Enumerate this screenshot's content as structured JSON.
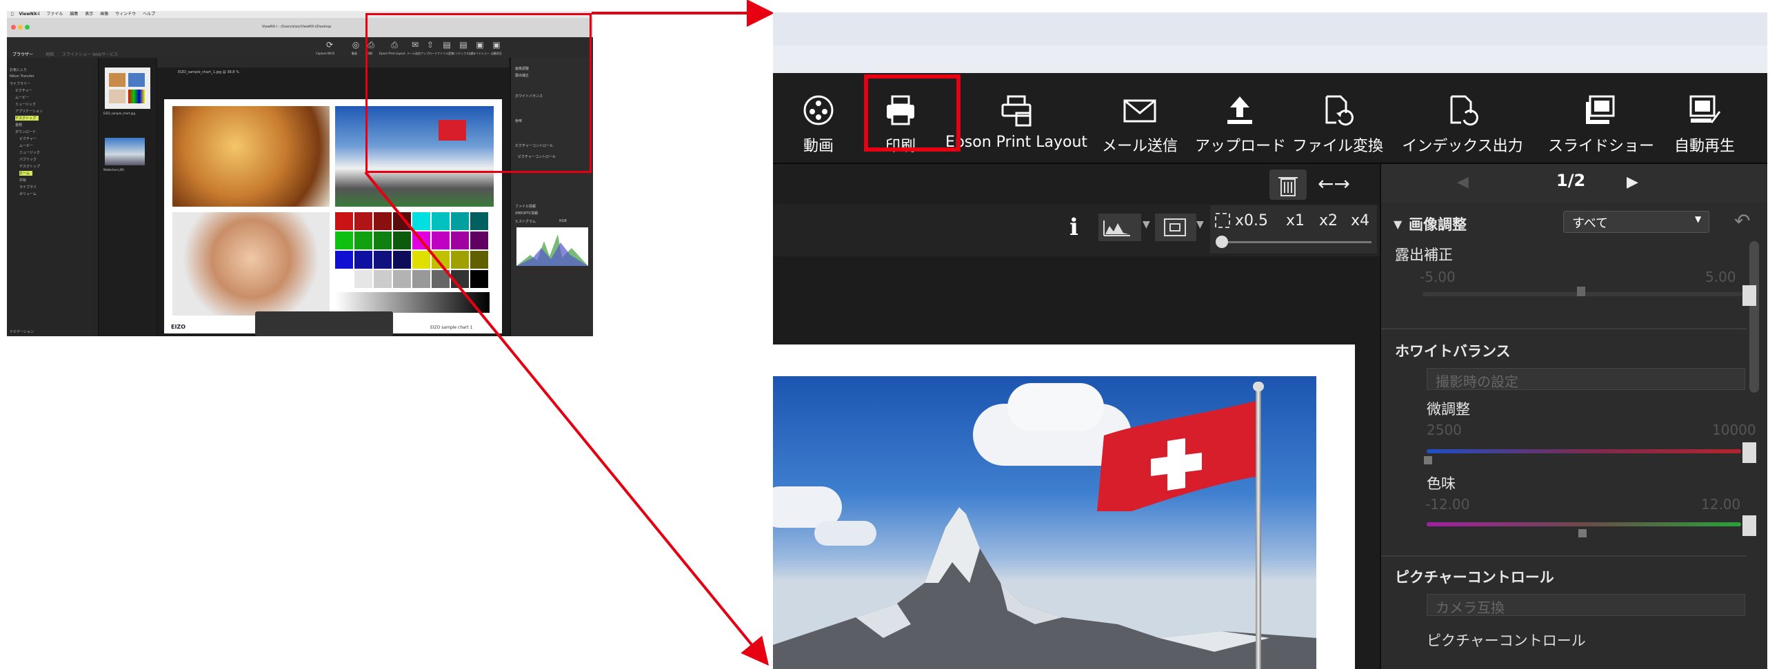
{
  "mini": {
    "menu": [
      "ViewNX-i",
      "ファイル",
      "編集",
      "表示",
      "画像",
      "ウィンドウ",
      "ヘルプ"
    ],
    "window_title": "ViewNX-i - /Users/eizo/ViewNX-i/Desktop",
    "tabs": [
      "ブラウザー",
      "地図",
      "スライドショー",
      "Webサービス"
    ],
    "toolbar_buttons": [
      "Capture NX-D",
      "動画",
      "印刷",
      "Epson Print Layout",
      "メール送信",
      "アップロード",
      "ファイル変換",
      "インデックス出力",
      "スライドショー",
      "自動再生"
    ],
    "tree": [
      "お気に入り",
      "Nikon Transfer",
      "ライブラリー",
      "ピクチャー",
      "ムービー",
      "ミュージック",
      "アプリケーション",
      "デスクトップ",
      "書類",
      "ダウンロード",
      "ピクチャー",
      "ムービー",
      "ミュージック",
      "パブリック",
      "デスクトップ",
      "ホーム",
      "共有",
      "ライブラリ",
      "ボリューム"
    ],
    "tree_highlights": [
      7,
      15
    ],
    "thumb_caption_1": "EIZO_sample_chart.jpg",
    "thumb_caption_2": "Matterhorn.JPG",
    "file_path": "EIZO_sample_chart_1.jpg @ 38.8 %",
    "chart_caption": "EIZO sample chart 1",
    "logo": "EIZO",
    "right_labels": [
      "画像調整",
      "露出補正",
      "ホワイトバランス",
      "色味",
      "ピクチャーコントロール",
      "ピクチャーコントロール"
    ],
    "right_lower_labels": [
      "ファイル情報",
      "XMP/IPTC情報",
      "ヒストグラム",
      "RGB"
    ],
    "bottom_left": "ナビゲーション"
  },
  "zoom": {
    "toolbar": [
      {
        "label": "動画",
        "icon": "movie-icon"
      },
      {
        "label": "印刷",
        "icon": "printer-icon"
      },
      {
        "label": "Epson Print Layout",
        "icon": "epson-print-layout-icon"
      },
      {
        "label": "メール送信",
        "icon": "mail-icon"
      },
      {
        "label": "アップロード",
        "icon": "upload-icon"
      },
      {
        "label": "ファイル変換",
        "icon": "file-convert-icon"
      },
      {
        "label": "インデックス出力",
        "icon": "index-output-icon"
      },
      {
        "label": "スライドショー",
        "icon": "slideshow-icon"
      },
      {
        "label": "自動再生",
        "icon": "autoplay-icon"
      }
    ],
    "view_controls": {
      "trash_icon": "trash-icon",
      "arrows": "←→",
      "info": "i",
      "zoom_labels": [
        "x0.5",
        "x1",
        "x2",
        "x4"
      ]
    },
    "right_panel": {
      "pager": "1/2",
      "section_title": "画像調整",
      "dropdown": "すべて",
      "exposure_label": "露出補正",
      "exposure_min": "-5.00",
      "exposure_max": "5.00",
      "wb_title": "ホワイトバランス",
      "wb_value": "撮影時の設定",
      "fine_label": "微調整",
      "fine_min": "2500",
      "fine_max": "10000",
      "tint_label": "色味",
      "tint_min": "-12.00",
      "tint_max": "12.00",
      "pc_title": "ピクチャーコントロール",
      "pc_value": "カメラ互換",
      "pc_sub": "ピクチャーコントロール"
    },
    "highlight_color": "#e60012"
  }
}
